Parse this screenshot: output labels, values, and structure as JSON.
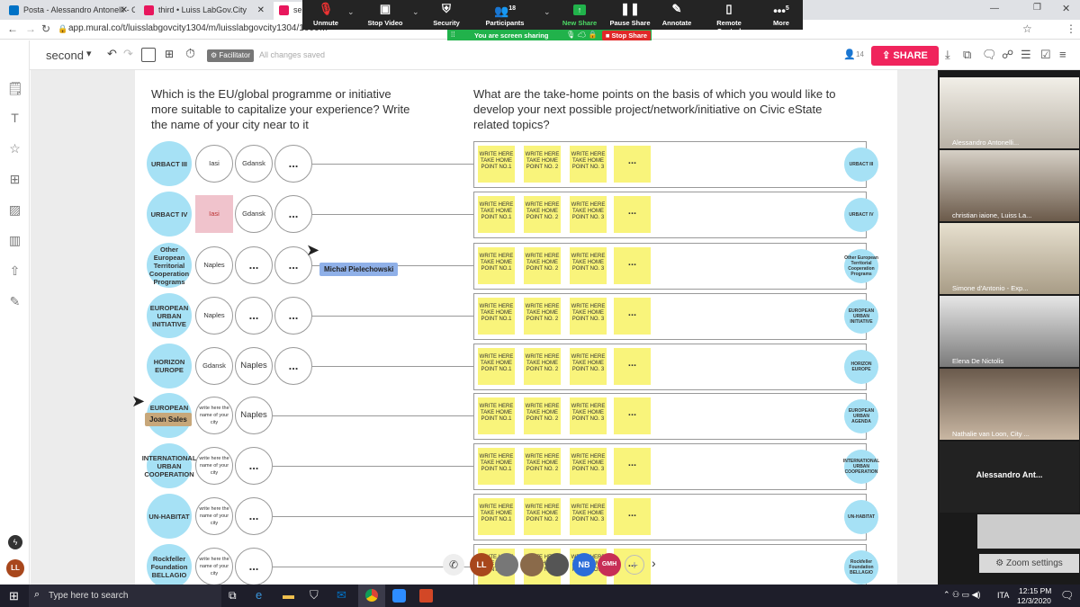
{
  "browser": {
    "tabs": [
      {
        "label": "Posta - Alessandro Antonelli - Ou",
        "color": "#0072c6"
      },
      {
        "label": "third • Luiss LabGov.City",
        "color": "#e8175d"
      },
      {
        "label": "se",
        "color": "#e8175d"
      }
    ],
    "url": "app.mural.co/t/luisslabgovcity1304/m/luisslabgovcity1304/1606…"
  },
  "zoom_toolbar": {
    "items": [
      {
        "label": "Unmute",
        "icon": "mic-muted-icon"
      },
      {
        "label": "Stop Video",
        "icon": "video-icon"
      },
      {
        "label": "Security",
        "icon": "shield-icon"
      },
      {
        "label": "Participants",
        "icon": "participants-icon",
        "count": "18"
      },
      {
        "label": "New Share",
        "icon": "share-icon"
      },
      {
        "label": "Pause Share",
        "icon": "pause-icon"
      },
      {
        "label": "Annotate",
        "icon": "pen-icon"
      },
      {
        "label": "Remote Control",
        "icon": "mouse-icon"
      },
      {
        "label": "More",
        "icon": "more-icon",
        "count": "5"
      }
    ],
    "sharing_text": "You are screen sharing",
    "stop_share": "Stop Share"
  },
  "mural_header": {
    "board_name": "second",
    "facilitator": "Facilitator",
    "save_status": "All changes saved",
    "member_count": "14",
    "share_label": "SHARE",
    "share_color": "#f0245c"
  },
  "questions": {
    "left": "Which is the EU/global programme or initiative more suitable to capitalize your experience? Write the name of your city near to it",
    "right": "What are the take-home points on the basis of which you would like to develop your next possible project/network/initiative on Civic eState related topics?"
  },
  "rows": [
    {
      "programme": "URBACT III",
      "cities": [
        "Iasi",
        "Gdansk",
        "..."
      ]
    },
    {
      "programme": "URBACT IV",
      "cities": [
        "Iasi",
        "Gdansk",
        "..."
      ]
    },
    {
      "programme": "Other European Territorial Cooperation Programs",
      "cities": [
        "Naples",
        "...",
        "..."
      ]
    },
    {
      "programme": "EUROPEAN URBAN INITIATIVE",
      "cities": [
        "Naples",
        "...",
        "..."
      ]
    },
    {
      "programme": "HORIZON EUROPE",
      "cities": [
        "Gdansk",
        "Naples",
        "..."
      ]
    },
    {
      "programme": "EUROPEAN URBAN AGENDA",
      "cities": [
        "write here the name of your city",
        "Naples"
      ]
    },
    {
      "programme": "INTERNATIONAL URBAN COOPERATION",
      "cities": [
        "write here the name of your city",
        "..."
      ]
    },
    {
      "programme": "UN-HABITAT",
      "cities": [
        "write here the name of your city",
        "..."
      ]
    },
    {
      "programme": "Rockfeller Foundation BELLAGIO",
      "cities": [
        "write here the name of your city",
        "..."
      ]
    }
  ],
  "stickies": [
    "WRITE HERE TAKE HOME POINT NO.1",
    "WRITE HERE TAKE HOME POINT NO. 2",
    "WRITE HERE TAKE HOME POINT NO. 3",
    "..."
  ],
  "cursors": [
    {
      "name": "Michał Pielechowski",
      "color": "#8fb0e8"
    },
    {
      "name": "Joan Sales",
      "color": "#c7a77a"
    }
  ],
  "videos": [
    {
      "name": "Alessandro Antonelli..."
    },
    {
      "name": "christian iaione, Luiss La..."
    },
    {
      "name": "Simone d'Antonio - Exp..."
    },
    {
      "name": "Elena De Nictolis"
    },
    {
      "name": "Nathalie van Loon, City ..."
    },
    {
      "name": "Alessandro Ant..."
    }
  ],
  "zoom_settings": "Zoom settings",
  "collaborators": [
    {
      "initials": "LL",
      "color": "#a8471c"
    },
    {
      "initials": "NB",
      "color": "#2b6cd9"
    },
    {
      "initials": "GMH",
      "color": "#c72e56"
    }
  ],
  "taskbar": {
    "search_placeholder": "Type here to search",
    "time": "12:15 PM",
    "date": "12/3/2020",
    "lang": "ITA"
  },
  "user_initials": "LL"
}
